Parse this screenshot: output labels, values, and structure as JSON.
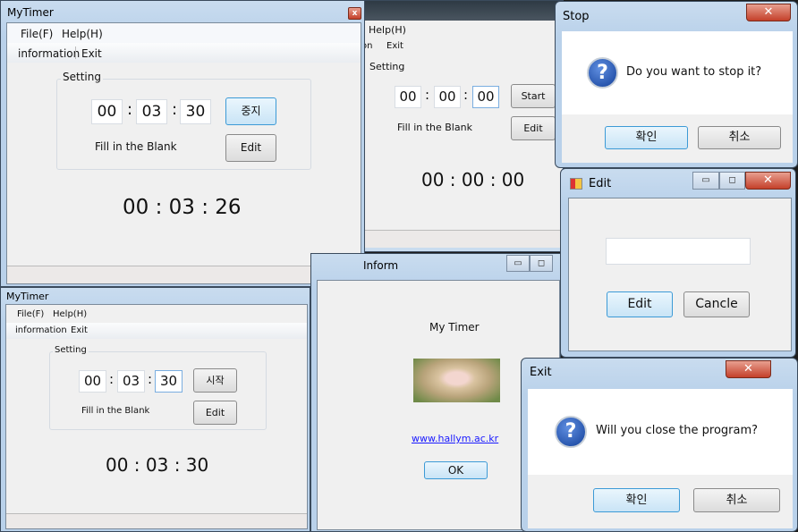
{
  "main_window": {
    "title": "MyTimer",
    "close": "x",
    "menu": [
      "File(F)",
      "Help(H)"
    ],
    "toolbar": [
      "information",
      "Exit"
    ],
    "group": "Setting",
    "hh": "00",
    "mm": "03",
    "ss": "30",
    "sep": ":",
    "stop_button": "중지",
    "edit_button": "Edit",
    "hint": "Fill in the Blank",
    "timer": "00 : 03 : 26"
  },
  "back_window": {
    "menu_help": "Help(H)",
    "toolbar": [
      "on",
      "Exit"
    ],
    "group": "Setting",
    "hh": "00",
    "mm": "00",
    "ss": "00",
    "sep": ":",
    "start_button": "Start",
    "edit_button": "Edit",
    "hint": "Fill in the Blank",
    "timer": "00 : 00 : 00"
  },
  "second_window": {
    "title": "MyTimer",
    "menu": [
      "File(F)",
      "Help(H)"
    ],
    "toolbar": [
      "information",
      "Exit"
    ],
    "group": "Setting",
    "hh": "00",
    "mm": "03",
    "ss": "30",
    "sep": ":",
    "start_button": "시작",
    "edit_button": "Edit",
    "hint": "Fill in the Blank",
    "timer": "00 : 03 : 30"
  },
  "stop_dialog": {
    "title": "Stop",
    "message": "Do you want to stop it?",
    "ok": "확인",
    "cancel": "취소",
    "icon": "question-icon"
  },
  "edit_dialog": {
    "title": "Edit",
    "input_value": "",
    "edit": "Edit",
    "cancel": "Cancle"
  },
  "inform_window": {
    "title": "Inform",
    "app_name": "My Timer",
    "link": "www.hallym.ac.kr",
    "ok": "OK"
  },
  "exit_dialog": {
    "title": "Exit",
    "message": "Will you close the program?",
    "ok": "확인",
    "cancel": "취소",
    "icon": "question-icon"
  },
  "colors": {
    "link": "#1a1aff",
    "default_button_border": "#3c9ad6",
    "close_button": "#c4402a"
  }
}
